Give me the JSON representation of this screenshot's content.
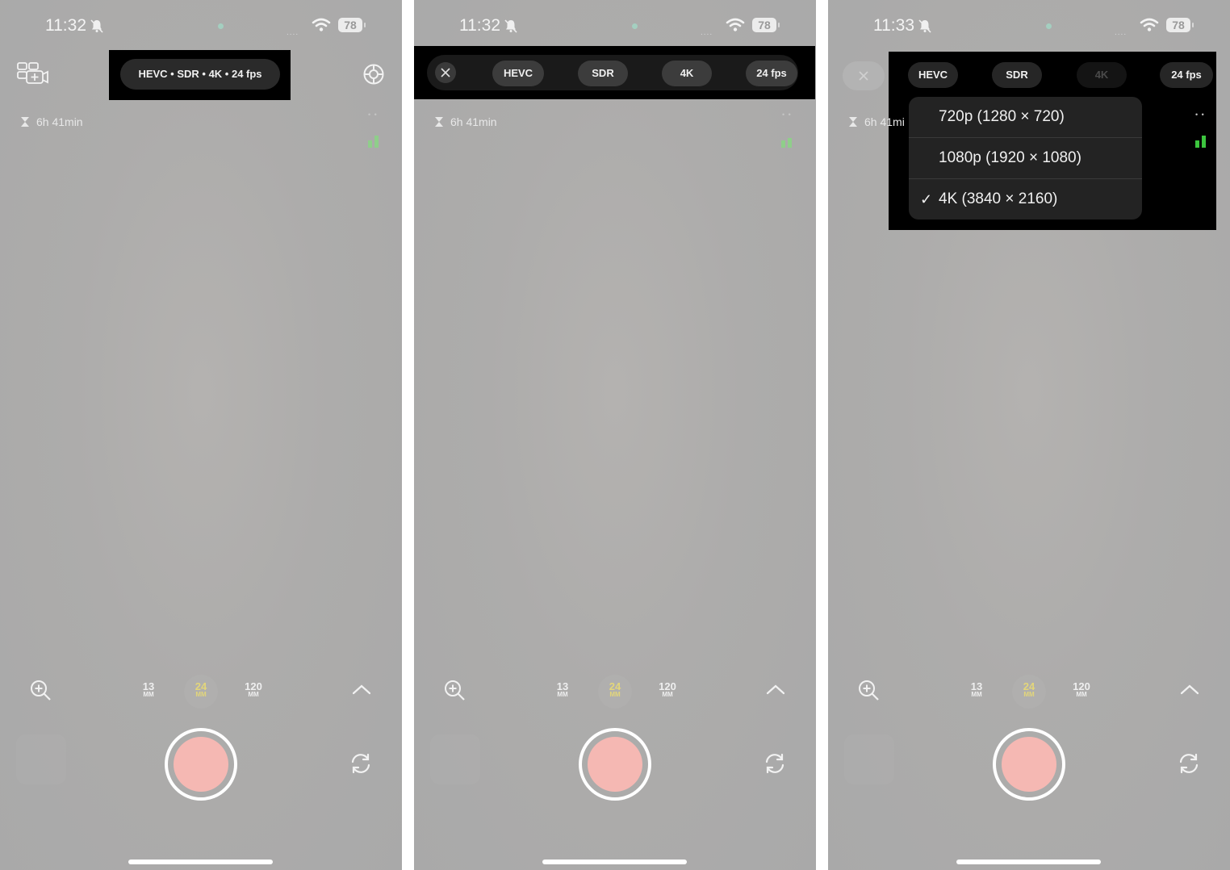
{
  "status": {
    "time_1": "11:32",
    "time_2": "11:32",
    "time_3": "11:33",
    "battery": "78",
    "signal": "...."
  },
  "summary_pill": "HEVC • SDR • 4K • 24 fps",
  "settings_pills": {
    "codec": "HEVC",
    "range": "SDR",
    "resolution": "4K",
    "fps": "24 fps"
  },
  "resolution_menu": {
    "items": [
      "720p (1280 × 720)",
      "1080p (1920 × 1080)",
      "4K (3840 × 2160)"
    ],
    "selected_check": "✓"
  },
  "timer": "6h 41min",
  "timer_truncated": "6h 41mi",
  "mini_dots": "• •",
  "lenses": [
    {
      "num": "13",
      "unit": "MM"
    },
    {
      "num": "24",
      "unit": "MM"
    },
    {
      "num": "120",
      "unit": "MM"
    }
  ],
  "colors": {
    "active_lens": "#e3d67a",
    "record_button": "#f5b8b3",
    "level_green_dim": "#8fce8a",
    "level_green": "#3cc53e"
  }
}
